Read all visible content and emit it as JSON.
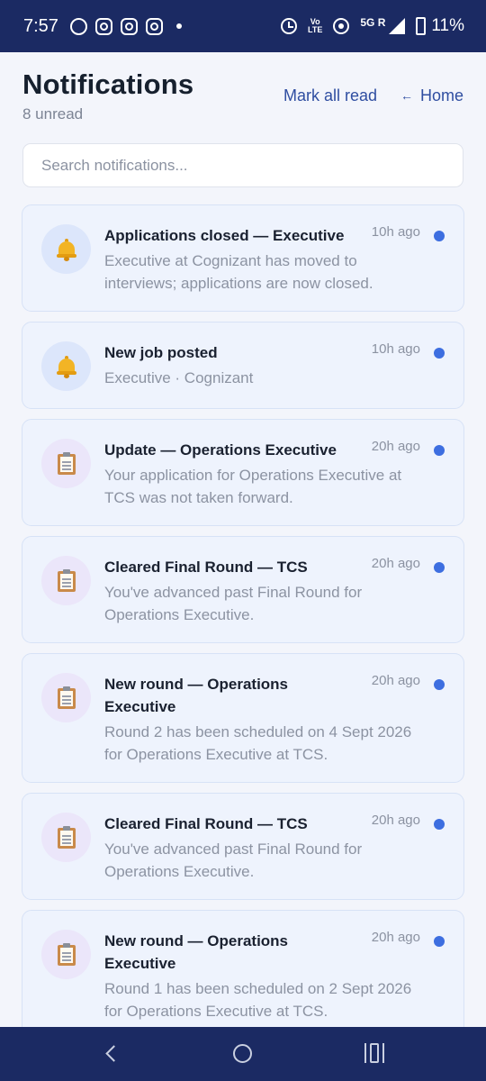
{
  "status_bar": {
    "time": "7:57",
    "lte_top": "Vo",
    "lte_bottom": "LTE",
    "network": "5G",
    "network_sub": "R",
    "battery": "11%"
  },
  "header": {
    "title": "Notifications",
    "unread": "8 unread",
    "mark_all_read": "Mark all read",
    "home_arrow": "←",
    "home": "Home"
  },
  "search": {
    "placeholder": "Search notifications..."
  },
  "notifications": [
    {
      "icon": "bell-icon",
      "title": "Applications closed — Executive",
      "time": "10h ago",
      "body": "Executive at Cognizant has moved to interviews; applications are now closed.",
      "unread": true
    },
    {
      "icon": "bell-icon",
      "title": "New job posted",
      "time": "10h ago",
      "body": "Executive · Cognizant",
      "unread": true
    },
    {
      "icon": "clipboard-icon",
      "title": "Update — Operations Executive",
      "time": "20h ago",
      "body": "Your application for Operations Executive at TCS was not taken forward.",
      "unread": true
    },
    {
      "icon": "clipboard-icon",
      "title": "Cleared Final Round — TCS",
      "time": "20h ago",
      "body": "You've advanced past Final Round for Operations Executive.",
      "unread": true
    },
    {
      "icon": "clipboard-icon",
      "title": "New round — Operations Executive",
      "time": "20h ago",
      "body": "Round 2 has been scheduled on 4 Sept 2026 for Operations Executive at TCS.",
      "unread": true
    },
    {
      "icon": "clipboard-icon",
      "title": "Cleared Final Round — TCS",
      "time": "20h ago",
      "body": "You've advanced past Final Round for Operations Executive.",
      "unread": true
    },
    {
      "icon": "clipboard-icon",
      "title": "New round — Operations Executive",
      "time": "20h ago",
      "body": "Round 1 has been scheduled on 2 Sept 2026 for Operations Executive at TCS.",
      "unread": true
    }
  ],
  "colors": {
    "status_bar": "#1b2a63",
    "accent": "#2f4ea1",
    "unread_dot": "#3d6ee0",
    "card_bg": "#eef3fd"
  }
}
